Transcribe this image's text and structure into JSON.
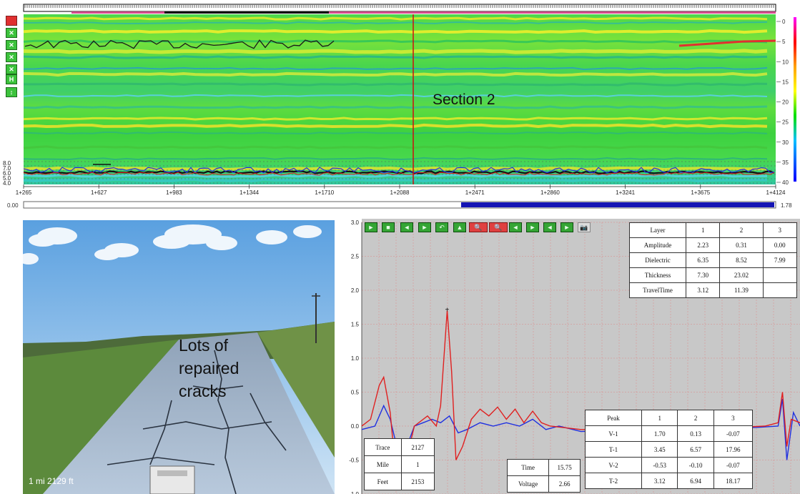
{
  "radargram": {
    "annotation": "Section 2",
    "depth_labels": [
      "0",
      "5",
      "10",
      "15",
      "20",
      "25",
      "30",
      "35",
      "40"
    ],
    "mile_ticks": [
      "1+265",
      "1+627",
      "1+983",
      "1+1344",
      "1+1710",
      "1+2088",
      "1+2471",
      "1+2860",
      "1+3241",
      "1+3675",
      "1+4124"
    ],
    "left_scale_labels": [
      "8.0",
      "7.0",
      "6.0",
      "5.0",
      "4.0"
    ],
    "scrollbar_min": "0.00",
    "scrollbar_max": "1.78",
    "side_tools": [
      "✕",
      "✕",
      "✕",
      "✕",
      "H",
      "↕"
    ]
  },
  "photo": {
    "caption": [
      "Lots of",
      "repaired",
      "cracks"
    ],
    "location": "1 mi  2129 ft"
  },
  "waveform": {
    "y_labels": [
      "3.0",
      "2.5",
      "2.0",
      "1.5",
      "1.0",
      "0.5",
      "0.0",
      "-0.5",
      "-1.0"
    ],
    "toolbar_icons": [
      "►",
      "■",
      "◄",
      "►",
      "↶",
      "▲",
      "🔍",
      "🔍",
      "◄",
      "►",
      "◄",
      "►",
      "📷"
    ]
  },
  "layer_table": {
    "header": [
      "Layer",
      "1",
      "2",
      "3"
    ],
    "rows": [
      [
        "Amplitude",
        "2.23",
        "0.31",
        "0.00"
      ],
      [
        "Dielectric",
        "6.35",
        "8.52",
        "7.99"
      ],
      [
        "Thickness",
        "7.30",
        "23.02",
        ""
      ],
      [
        "TravelTime",
        "3.12",
        "11.39",
        ""
      ]
    ]
  },
  "peak_table": {
    "header": [
      "Peak",
      "1",
      "2",
      "3"
    ],
    "rows": [
      [
        "V-1",
        "1.70",
        "0.13",
        "-0.07"
      ],
      [
        "T-1",
        "3.45",
        "6.57",
        "17.96"
      ],
      [
        "V-2",
        "-0.53",
        "-0.10",
        "-0.07"
      ],
      [
        "T-2",
        "3.12",
        "6.94",
        "18.17"
      ]
    ]
  },
  "trace_table": {
    "rows": [
      [
        "Trace",
        "2127"
      ],
      [
        "Mile",
        "1"
      ],
      [
        "Feet",
        "2153"
      ]
    ]
  },
  "time_table": {
    "rows": [
      [
        "Time",
        "15.75"
      ],
      [
        "Voltage",
        "2.66"
      ]
    ]
  },
  "colors": {
    "radar_green": "#3fd83f",
    "trace_red": "#e02020",
    "trace_blue": "#2030e0",
    "panel_gray": "#c8c8c8",
    "scroll_blue": "#1414b4"
  }
}
